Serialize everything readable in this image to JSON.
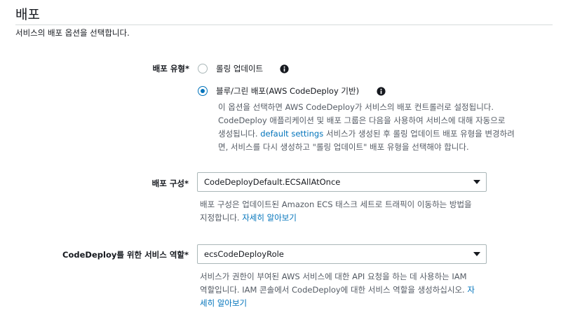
{
  "section": {
    "title": "배포",
    "description": "서비스의 배포 옵션을 선택합니다."
  },
  "deployment_type": {
    "label": "배포 유형*",
    "options": [
      {
        "label": "롤링 업데이트",
        "selected": false
      },
      {
        "label": "블루/그린 배포(AWS CodeDeploy 기반)",
        "selected": true
      }
    ],
    "help": {
      "line1": "이 옵션을 선택하면 AWS CodeDeploy가 서비스의 배포 컨트롤러로 설정됩니다.",
      "line2": "CodeDeploy 애플리케이션 및 배포 그룹은 다음을 사용하여 서비스에 대해 자동으로",
      "line3_prefix": "생성됩니다. ",
      "line3_link": "default settings",
      "line3_suffix": " 서비스가 생성된 후 롤링 업데이트 배포 유형을 변경하려",
      "line4": "면, 서비스를 다시 생성하고 \"롤링 업데이트\" 배포 유형을 선택해야 합니다."
    }
  },
  "deployment_config": {
    "label": "배포 구성*",
    "value": "CodeDeployDefault.ECSAllAtOnce",
    "help": {
      "line1": "배포 구성은 업데이트된 Amazon ECS 태스크 세트로 트래픽이 이동하는 방법을",
      "line2_prefix": "지정합니다. ",
      "line2_link": "자세히 알아보기"
    }
  },
  "service_role": {
    "label": "CodeDeploy를 위한 서비스 역할*",
    "value": "ecsCodeDeployRole",
    "help": {
      "line1": "서비스가 권한이 부여된 AWS 서비스에 대한 API 요청을 하는 데 사용하는 IAM",
      "line2_prefix": "역할입니다. IAM 콘솔에서 CodeDeploy에 대한 서비스 역할을 생성하십시오. ",
      "line2_link": "자",
      "line3_link": "세히 알아보기"
    }
  },
  "colors": {
    "accent": "#0073bb",
    "text": "#16191f",
    "help_text": "#545b64",
    "border": "#aab7b8"
  },
  "icons": {
    "info": "info-icon",
    "dropdown": "caret-down-icon"
  }
}
